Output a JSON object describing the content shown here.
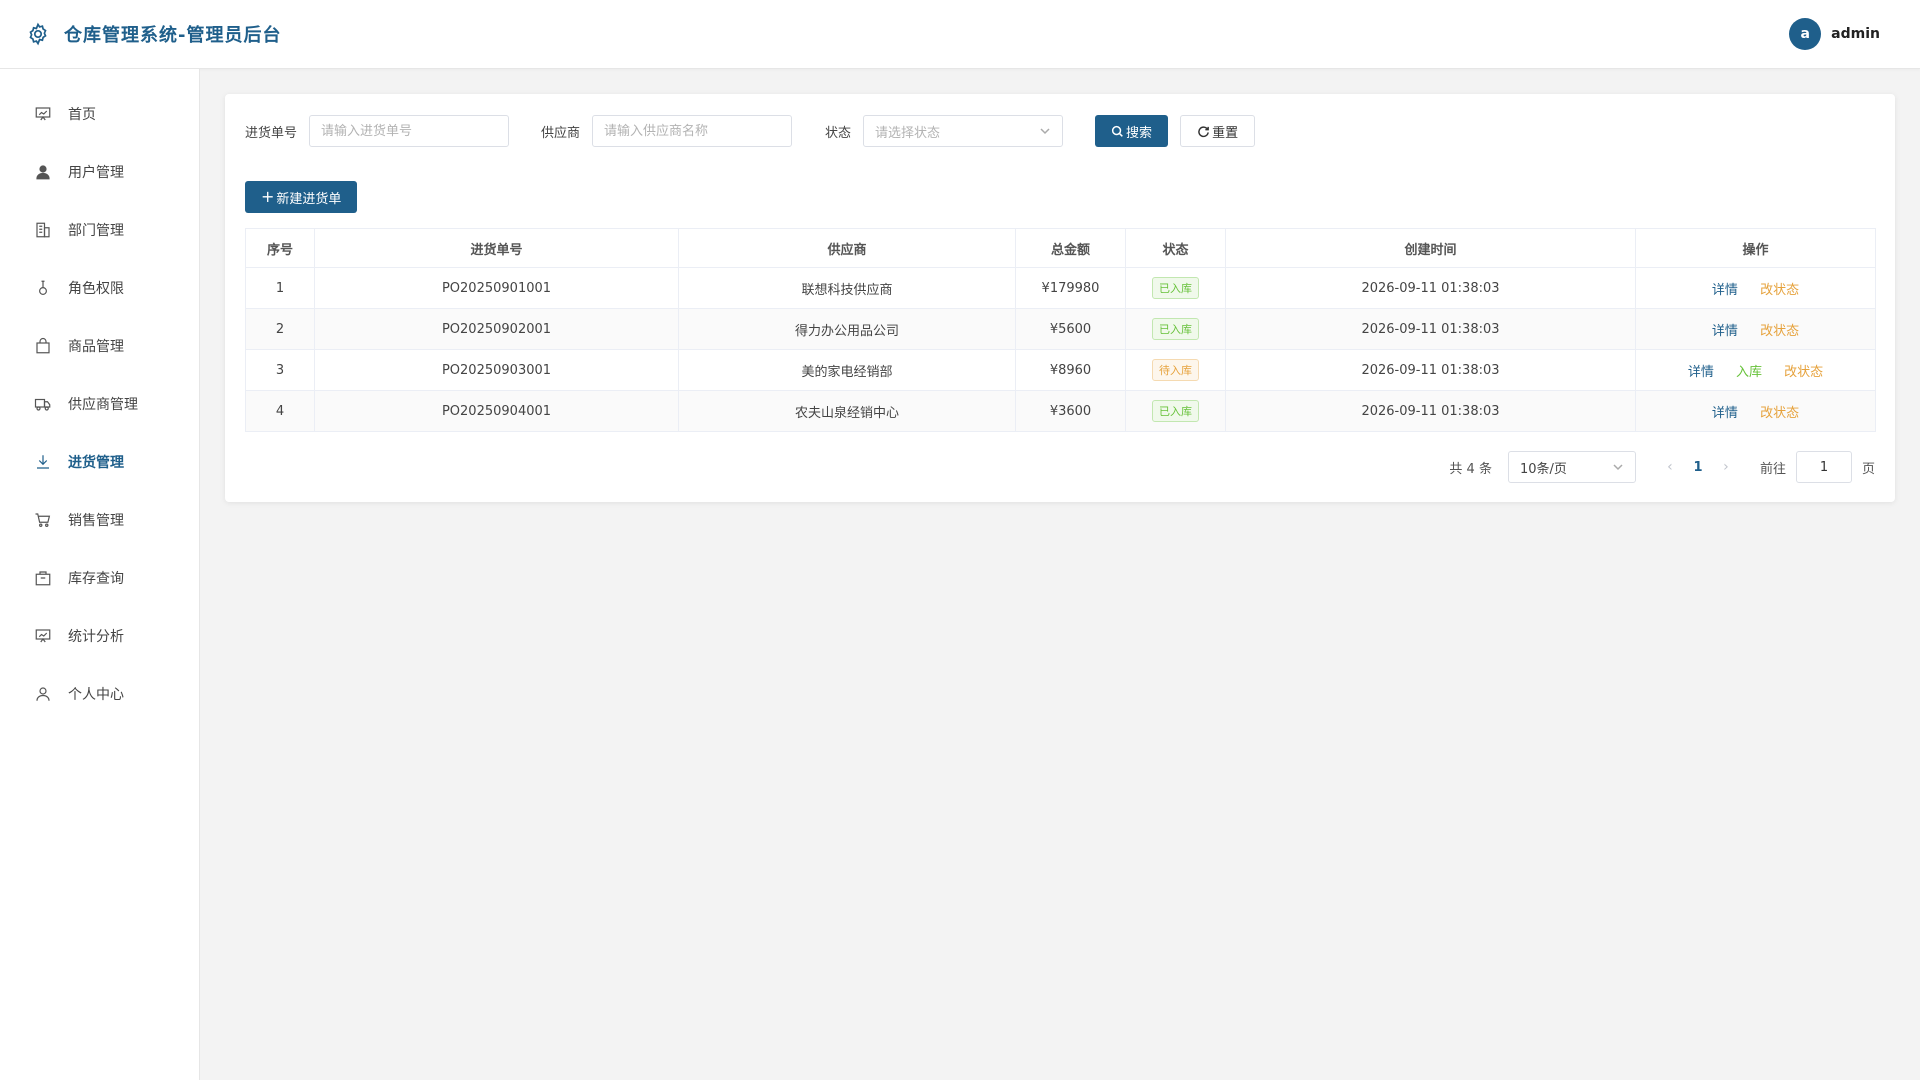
{
  "app": {
    "title": "仓库管理系统-管理员后台"
  },
  "user": {
    "initial": "a",
    "name": "admin"
  },
  "sidebar": {
    "items": [
      {
        "label": "首页",
        "icon": "dashboard-icon",
        "active": false
      },
      {
        "label": "用户管理",
        "icon": "user-icon",
        "active": false
      },
      {
        "label": "部门管理",
        "icon": "building-icon",
        "active": false
      },
      {
        "label": "角色权限",
        "icon": "role-icon",
        "active": false
      },
      {
        "label": "商品管理",
        "icon": "bag-icon",
        "active": false
      },
      {
        "label": "供应商管理",
        "icon": "truck-icon",
        "active": false
      },
      {
        "label": "进货管理",
        "icon": "download-icon",
        "active": true
      },
      {
        "label": "销售管理",
        "icon": "cart-icon",
        "active": false
      },
      {
        "label": "库存查询",
        "icon": "box-icon",
        "active": false
      },
      {
        "label": "统计分析",
        "icon": "chart-board-icon",
        "active": false
      },
      {
        "label": "个人中心",
        "icon": "person-icon",
        "active": false
      }
    ]
  },
  "filters": {
    "order_no_label": "进货单号",
    "order_no_placeholder": "请输入进货单号",
    "supplier_label": "供应商",
    "supplier_placeholder": "请输入供应商名称",
    "status_label": "状态",
    "status_placeholder": "请选择状态",
    "search_button": "搜索",
    "reset_button": "重置"
  },
  "toolbar": {
    "add_button": "新建进货单"
  },
  "table": {
    "headers": [
      "序号",
      "进货单号",
      "供应商",
      "总金额",
      "状态",
      "创建时间",
      "操作"
    ],
    "rows": [
      {
        "index": "1",
        "order_no": "PO20250901001",
        "supplier": "联想科技供应商",
        "amount": "¥179980",
        "status": "已入库",
        "status_type": "ok",
        "created": "2026-09-11 01:38:03",
        "actions": [
          "详情",
          "改状态"
        ]
      },
      {
        "index": "2",
        "order_no": "PO20250902001",
        "supplier": "得力办公用品公司",
        "amount": "¥5600",
        "status": "已入库",
        "status_type": "ok",
        "created": "2026-09-11 01:38:03",
        "actions": [
          "详情",
          "改状态"
        ]
      },
      {
        "index": "3",
        "order_no": "PO20250903001",
        "supplier": "美的家电经销部",
        "amount": "¥8960",
        "status": "待入库",
        "status_type": "wait",
        "created": "2026-09-11 01:38:03",
        "actions": [
          "详情",
          "入库",
          "改状态"
        ]
      },
      {
        "index": "4",
        "order_no": "PO20250904001",
        "supplier": "农夫山泉经销中心",
        "amount": "¥3600",
        "status": "已入库",
        "status_type": "ok",
        "created": "2026-09-11 01:38:03",
        "actions": [
          "详情",
          "改状态"
        ]
      }
    ]
  },
  "pagination": {
    "total_text": "共 4 条",
    "page_size": "10条/页",
    "current_page": "1",
    "goto_label": "前往",
    "goto_value": "1",
    "page_suffix": "页"
  },
  "colors": {
    "primary": "#1f5f8b",
    "success": "#67c23a",
    "warning": "#e6a23c"
  }
}
